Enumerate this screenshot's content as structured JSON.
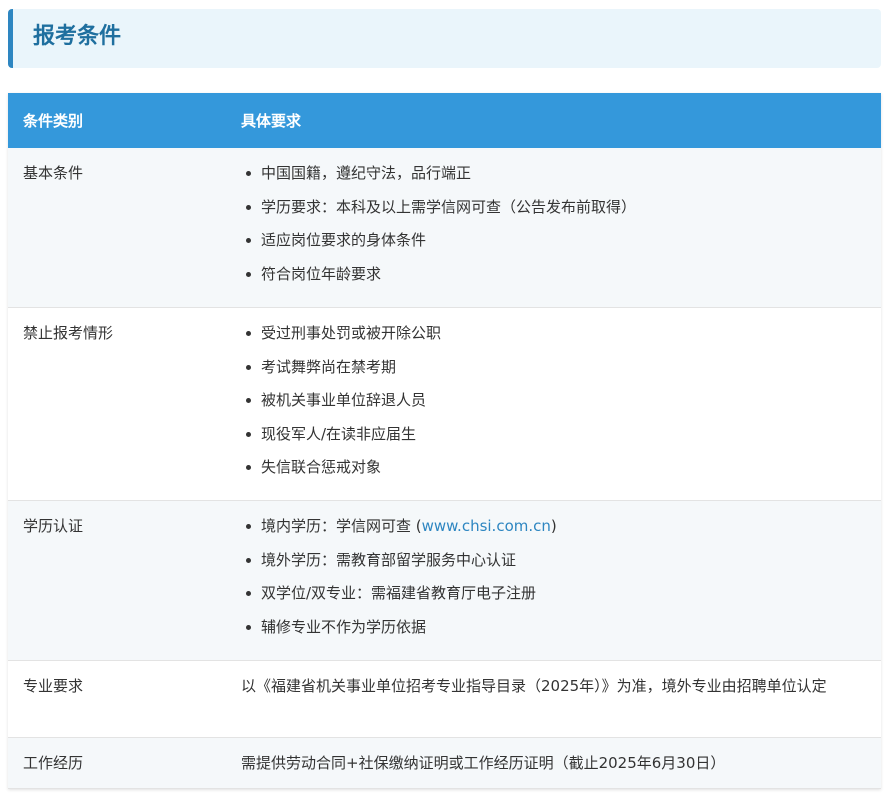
{
  "section": {
    "title": "报考条件"
  },
  "table": {
    "headers": [
      "条件类别",
      "具体要求"
    ],
    "rows": [
      {
        "category": "基本条件",
        "items": [
          "中国国籍，遵纪守法，品行端正",
          "学历要求：本科及以上需学信网可查（公告发布前取得）",
          "适应岗位要求的身体条件",
          "符合岗位年龄要求"
        ]
      },
      {
        "category": "禁止报考情形",
        "items": [
          "受过刑事处罚或被开除公职",
          "考试舞弊尚在禁考期",
          "被机关事业单位辞退人员",
          "现役军人/在读非应届生",
          "失信联合惩戒对象"
        ]
      },
      {
        "category": "学历认证",
        "items_prefix": "境内学历：学信网可查 (",
        "link": "www.chsi.com.cn",
        "items_suffix": ")",
        "items": [
          "境外学历：需教育部留学服务中心认证",
          "双学位/双专业：需福建省教育厅电子注册",
          "辅修专业不作为学历依据"
        ]
      },
      {
        "category": "专业要求",
        "text": "以《福建省机关事业单位招考专业指导目录（2025年）》为准，境外专业由招聘单位认定"
      },
      {
        "category": "工作经历",
        "text": "需提供劳动合同+社保缴纳证明或工作经历证明（截止2025年6月30日）"
      }
    ]
  }
}
